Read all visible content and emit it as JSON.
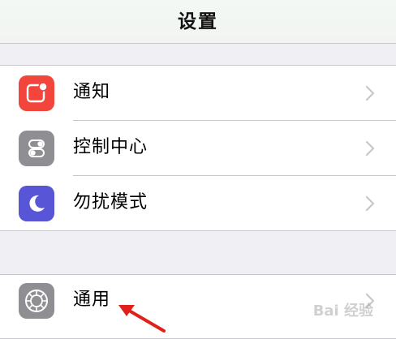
{
  "nav": {
    "title": "设置"
  },
  "group1": {
    "items": [
      {
        "label": "通知",
        "icon": "notification-icon"
      },
      {
        "label": "控制中心",
        "icon": "control-center-icon"
      },
      {
        "label": "勿扰模式",
        "icon": "do-not-disturb-moon-icon"
      }
    ]
  },
  "group2": {
    "items": [
      {
        "label": "通用",
        "icon": "gear-icon"
      }
    ]
  },
  "colors": {
    "notify": "#f2463c",
    "control": "#8e8e93",
    "dnd": "#5856d6",
    "general": "#8e8e93",
    "annotation_arrow": "#e0201a"
  },
  "watermark": {
    "text": "Bai 经验"
  }
}
